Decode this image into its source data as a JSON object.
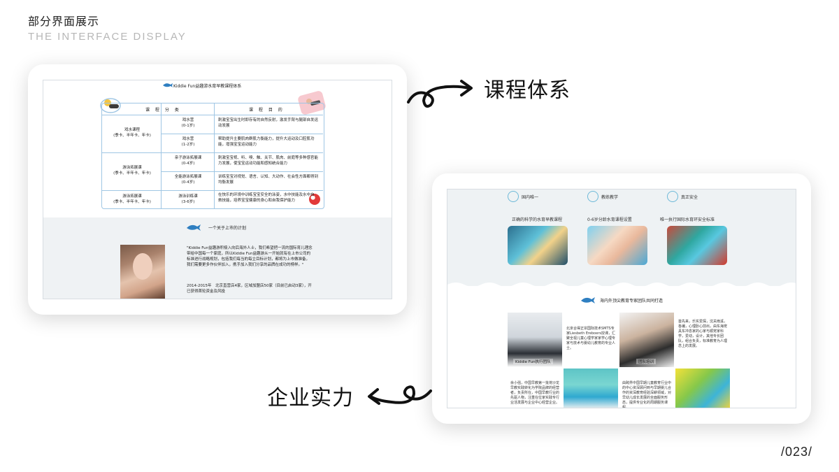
{
  "header": {
    "title_cn": "部分界面展示",
    "title_en": "THE INTERFACE DISPLAY"
  },
  "labels": {
    "course_system": "课程体系",
    "company_strength": "企业实力"
  },
  "page_number": "/023/",
  "left_screen": {
    "brand_header": "Kiddie Fun益趣游水育早教课程体系",
    "table_headers": [
      "课 程 分 类",
      "课 程 目 的"
    ],
    "rows": [
      {
        "category": "戏水课程",
        "category_sub": "(季卡、半年卡、年卡)",
        "courses": [
          {
            "name": "戏水营",
            "age": "(0-1岁)",
            "purpose": "刺激宝宝出生时即存有的自然反射，激发手臂与腿部自发运动发展"
          },
          {
            "name": "戏水营",
            "age": "(1-2岁)",
            "purpose": "帮助提升主要肌肉群肌力衡能力，提升大运动及口腔肌功能，增强宝宝运动能力"
          }
        ]
      },
      {
        "category": "游泳拓展课",
        "category_sub": "(季卡、半年卡、年卡)",
        "courses": [
          {
            "name": "亲子游泳拓展课",
            "age": "(0-4岁)",
            "purpose": "刺激宝宝视、听、嗅、触、关节、肌肉、前庭等多种感官能力发展，使宝宝运动功能和感知统合能力"
          },
          {
            "name": "全能游泳拓展课",
            "age": "(0-4岁)",
            "purpose": "训练宝宝对视觉、语言、认知、大动作、社会性方面都得到均衡发展"
          }
        ]
      },
      {
        "category": "游泳拓展课",
        "category_sub": "(季卡、半年卡、年卡)",
        "courses": [
          {
            "name": "游泳训练课",
            "age": "(3-6岁)",
            "purpose": "在快乐的环境中训练宝宝安全的泳姿，水中技能及水中自救技能，培养宝宝健康的身心和自我保护能力"
          }
        ]
      }
    ],
    "plan_title": "一个关于上市的计划",
    "quote": "\"Kiddie Fun益趣游积极入向后海外人士，我们希望把一流的国际育儿理念带给中国每一个家庭，所以Kiddie Fun益趣游从一开始就有在上市公司的标准进行战略规划，包括我们每当的每立目标计划，都将为上市做准备，我们需要更多作伙伴加入，携手加入我们分享的品牌在成功的榜样。\"",
    "milestone": "2014-2015年　北京直营店4家，区域加盟店50家（目前已启动3家），开已获得首轮资金及风投"
  },
  "right_screen": {
    "features": [
      {
        "title": "国内唯一",
        "desc": "正确的科学的水育早教课程"
      },
      {
        "title": "教练教学",
        "desc": "0-6岁分龄水育课程设置"
      },
      {
        "title": "真正安全",
        "desc": "唯一执行国际水育环安全标准"
      }
    ],
    "team_title": "海内外顶尖教育专家团队共同打造",
    "grid": {
      "caption_kiddie": "Kiddie Fun执行团队",
      "caption_coach": "团队培训",
      "text_expert": "北京合得正宗国际技术SMTS专家Liesbeth Ereboers授课，汇聚全视儿童心理学家家学心理专家与技术与婴幼儿教育的专业人士。",
      "text_staff": "首先来，乐实爱探，沈关雨溪，各编，心理卧心前出，由东海宠具东冲息家的心家与顺宠家科学，爱动，设计，其他专长团队，组合负责，标准教育为人理念上的发展。",
      "text_founder": "余小强，中国早教第一批将沙龙早教实践转化为学院品牌的经营者，负责所在，中国早教行业的先驱人物，注重在位家实践专行业活发展与企业中心经营企业。",
      "text_team": "由跨界中国早期儿童教育行业中的中心资深顾问到与早期婴儿合作的资深教育经验深耕领域，对早幼儿成长发展的全面服务形态，提供专业化的周期服务课程。"
    }
  }
}
